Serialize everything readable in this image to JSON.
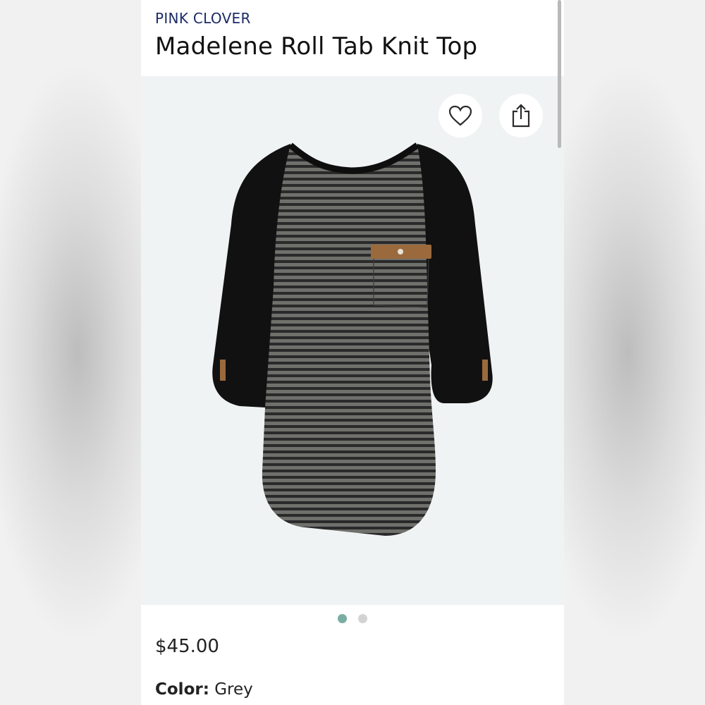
{
  "product": {
    "brand": "PINK CLOVER",
    "title": "Madelene Roll Tab Knit Top",
    "price": "$45.00",
    "color_label": "Color:",
    "color_value": "Grey"
  },
  "image": {
    "subject": "grey striped raglan knit top with black sleeves and tan pocket tab",
    "carousel_count": 2,
    "active_index": 0
  },
  "actions": {
    "favorite_icon": "heart-icon",
    "share_icon": "share-icon"
  },
  "colors": {
    "brand": "#1c2b66",
    "active_dot": "#7aaea3",
    "inactive_dot": "#d3d3d3",
    "image_bg": "#f0f3f3"
  }
}
